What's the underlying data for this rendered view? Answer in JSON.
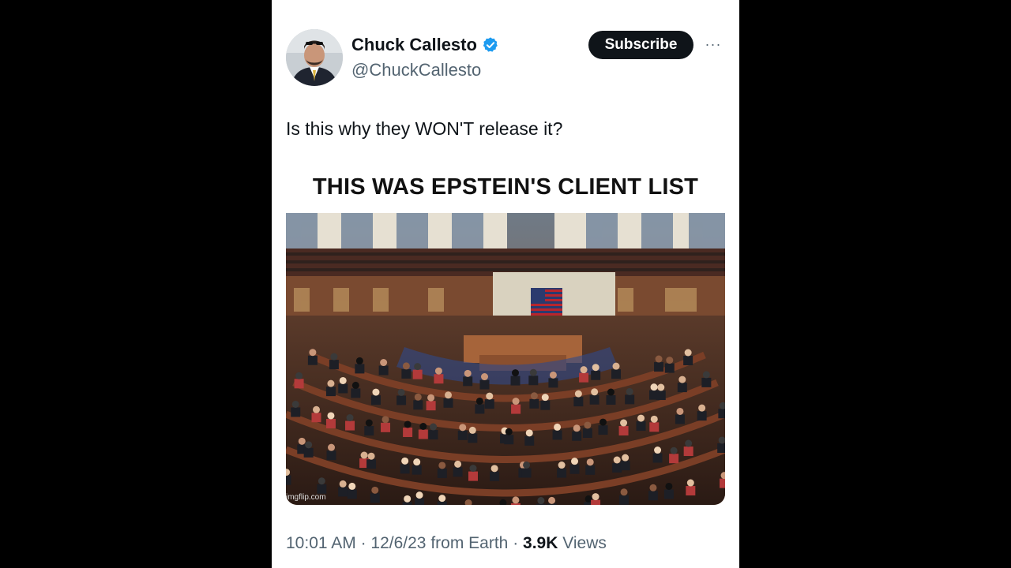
{
  "author": {
    "display_name": "Chuck Callesto",
    "handle": "@ChuckCallesto",
    "verified_icon": "verified-badge-icon",
    "avatar": "avatar"
  },
  "actions": {
    "subscribe_label": "Subscribe",
    "more_icon": "more-horizontal-icon",
    "more_label": "···"
  },
  "tweet": {
    "text": "Is this why they WON'T release it?"
  },
  "media": {
    "caption": "THIS WAS EPSTEIN'S CLIENT LIST",
    "watermark": "imgflip.com"
  },
  "meta": {
    "time": "10:01 AM",
    "sep1": " · ",
    "date": "12/6/23",
    "source": " from Earth",
    "sep2": " · ",
    "views_count": "3.9K",
    "views_label": " Views"
  },
  "colors": {
    "accent_verified": "#1d9bf0",
    "text_primary": "#0f1419",
    "text_secondary": "#536471",
    "button_bg": "#0f1419"
  }
}
